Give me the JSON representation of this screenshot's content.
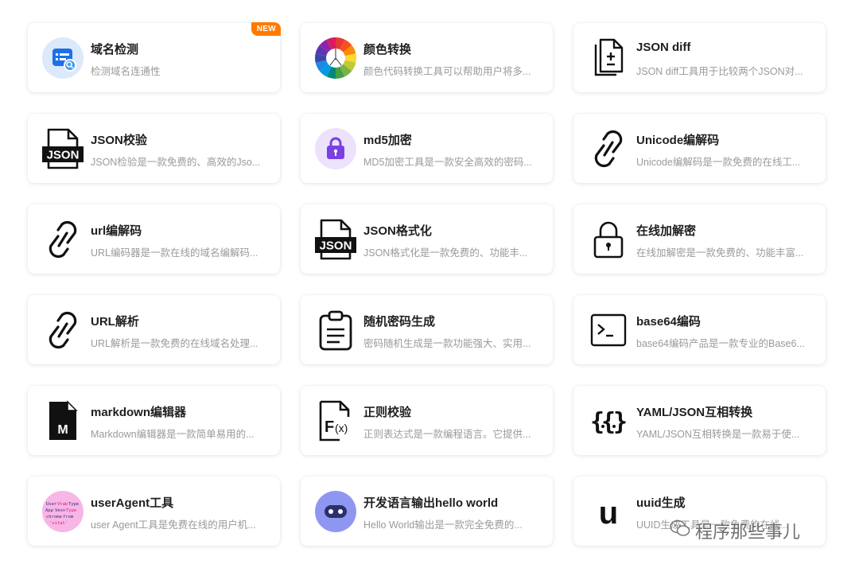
{
  "tools": [
    {
      "title": "域名检测",
      "desc": "检测域名连通性",
      "icon": "domain-check-icon",
      "badge": "NEW"
    },
    {
      "title": "颜色转换",
      "desc": "颜色代码转换工具可以帮助用户将多...",
      "icon": "color-wheel-icon"
    },
    {
      "title": "JSON diff",
      "desc": "JSON diff工具用于比较两个JSON对...",
      "icon": "file-diff-icon"
    },
    {
      "title": "JSON校验",
      "desc": "JSON检验是一款免费的、高效的Jso...",
      "icon": "json-file-icon"
    },
    {
      "title": "md5加密",
      "desc": "MD5加密工具是一款安全高效的密码...",
      "icon": "purple-lock-icon"
    },
    {
      "title": "Unicode编解码",
      "desc": "Unicode编解码是一款免费的在线工...",
      "icon": "link-icon"
    },
    {
      "title": "url编解码",
      "desc": "URL编码器是一款在线的域名编解码...",
      "icon": "link-icon"
    },
    {
      "title": "JSON格式化",
      "desc": "JSON格式化是一款免费的、功能丰...",
      "icon": "json-file-icon"
    },
    {
      "title": "在线加解密",
      "desc": "在线加解密是一款免费的、功能丰富...",
      "icon": "padlock-icon"
    },
    {
      "title": "URL解析",
      "desc": "URL解析是一款免费的在线域名处理...",
      "icon": "link-icon"
    },
    {
      "title": "随机密码生成",
      "desc": "密码随机生成是一款功能强大、实用...",
      "icon": "clipboard-icon"
    },
    {
      "title": "base64编码",
      "desc": "base64编码产品是一款专业的Base6...",
      "icon": "terminal-icon"
    },
    {
      "title": "markdown编辑器",
      "desc": "Markdown编辑器是一款简单易用的...",
      "icon": "markdown-file-icon"
    },
    {
      "title": "正则校验",
      "desc": "正则表达式是一款编程语言。它提供...",
      "icon": "function-file-icon"
    },
    {
      "title": "YAML/JSON互相转换",
      "desc": "YAML/JSON互相转换是一款易于使...",
      "icon": "braces-icon"
    },
    {
      "title": "userAgent工具",
      "desc": "user Agent工具是免费在线的用户机...",
      "icon": "user-agent-icon"
    },
    {
      "title": "开发语言输出hello world",
      "desc": "Hello World输出是一款完全免费的...",
      "icon": "robot-icon"
    },
    {
      "title": "uuid生成",
      "desc": "UUID生成工具是一款免费的在线...",
      "icon": "uuid-letter-icon"
    }
  ],
  "watermark": "程序那些事儿"
}
